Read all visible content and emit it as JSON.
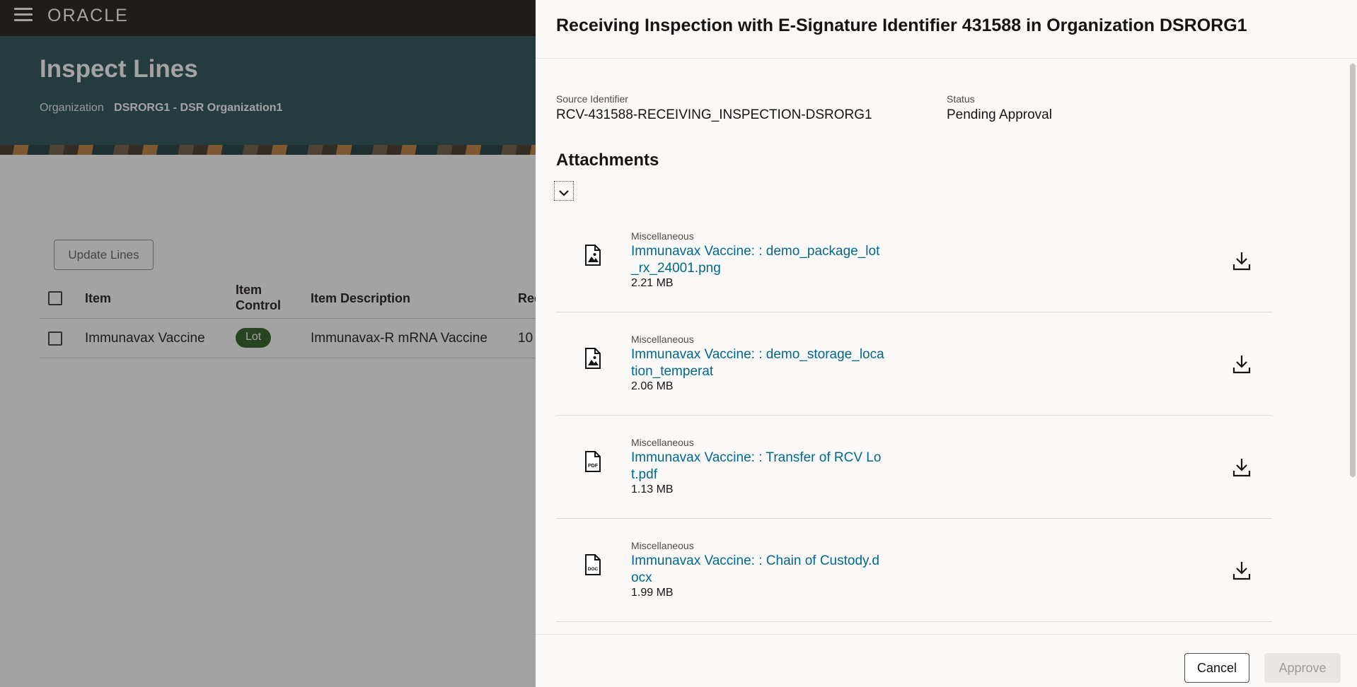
{
  "app": {
    "logo": "ORACLE"
  },
  "page": {
    "title": "Inspect Lines",
    "org_label": "Organization",
    "org_value": "DSRORG1 - DSR Organization1",
    "update_lines_label": "Update Lines",
    "table": {
      "headers": {
        "item": "Item",
        "item_control": "Item Control",
        "item_description": "Item Description",
        "rec_partial": "Rec"
      },
      "rows": [
        {
          "item": "Immunavax Vaccine",
          "item_control": "Lot",
          "item_description": "Immunavax-R mRNA Vaccine",
          "rec_partial": "10"
        }
      ]
    }
  },
  "drawer": {
    "title": "Receiving Inspection with E-Signature Identifier 431588 in Organization DSRORG1",
    "source_identifier_label": "Source Identifier",
    "source_identifier_value": "RCV-431588-RECEIVING_INSPECTION-DSRORG1",
    "status_label": "Status",
    "status_value": "Pending Approval",
    "attachments_heading": "Attachments",
    "attachments": [
      {
        "category": "Miscellaneous",
        "name": "Immunavax Vaccine: : demo_package_lot_rx_24001.png",
        "size": "2.21 MB",
        "icon": "image-file-icon"
      },
      {
        "category": "Miscellaneous",
        "name": "Immunavax Vaccine: : demo_storage_location_temperat",
        "size": "2.06 MB",
        "icon": "image-file-icon"
      },
      {
        "category": "Miscellaneous",
        "name": "Immunavax Vaccine: : Transfer of RCV Lot.pdf",
        "size": "1.13 MB",
        "icon": "pdf-file-icon"
      },
      {
        "category": "Miscellaneous",
        "name": "Immunavax Vaccine: : Chain of Custody.docx",
        "size": "1.99 MB",
        "icon": "doc-file-icon"
      }
    ],
    "icon_labels": {
      "pdf": "PDF",
      "doc": "DOC"
    },
    "cancel_label": "Cancel",
    "approve_label": "Approve"
  },
  "colors": {
    "topbar": "#312d2a",
    "banner": "#3a5e62",
    "link": "#00688c",
    "lot_badge": "#3e6b34"
  }
}
